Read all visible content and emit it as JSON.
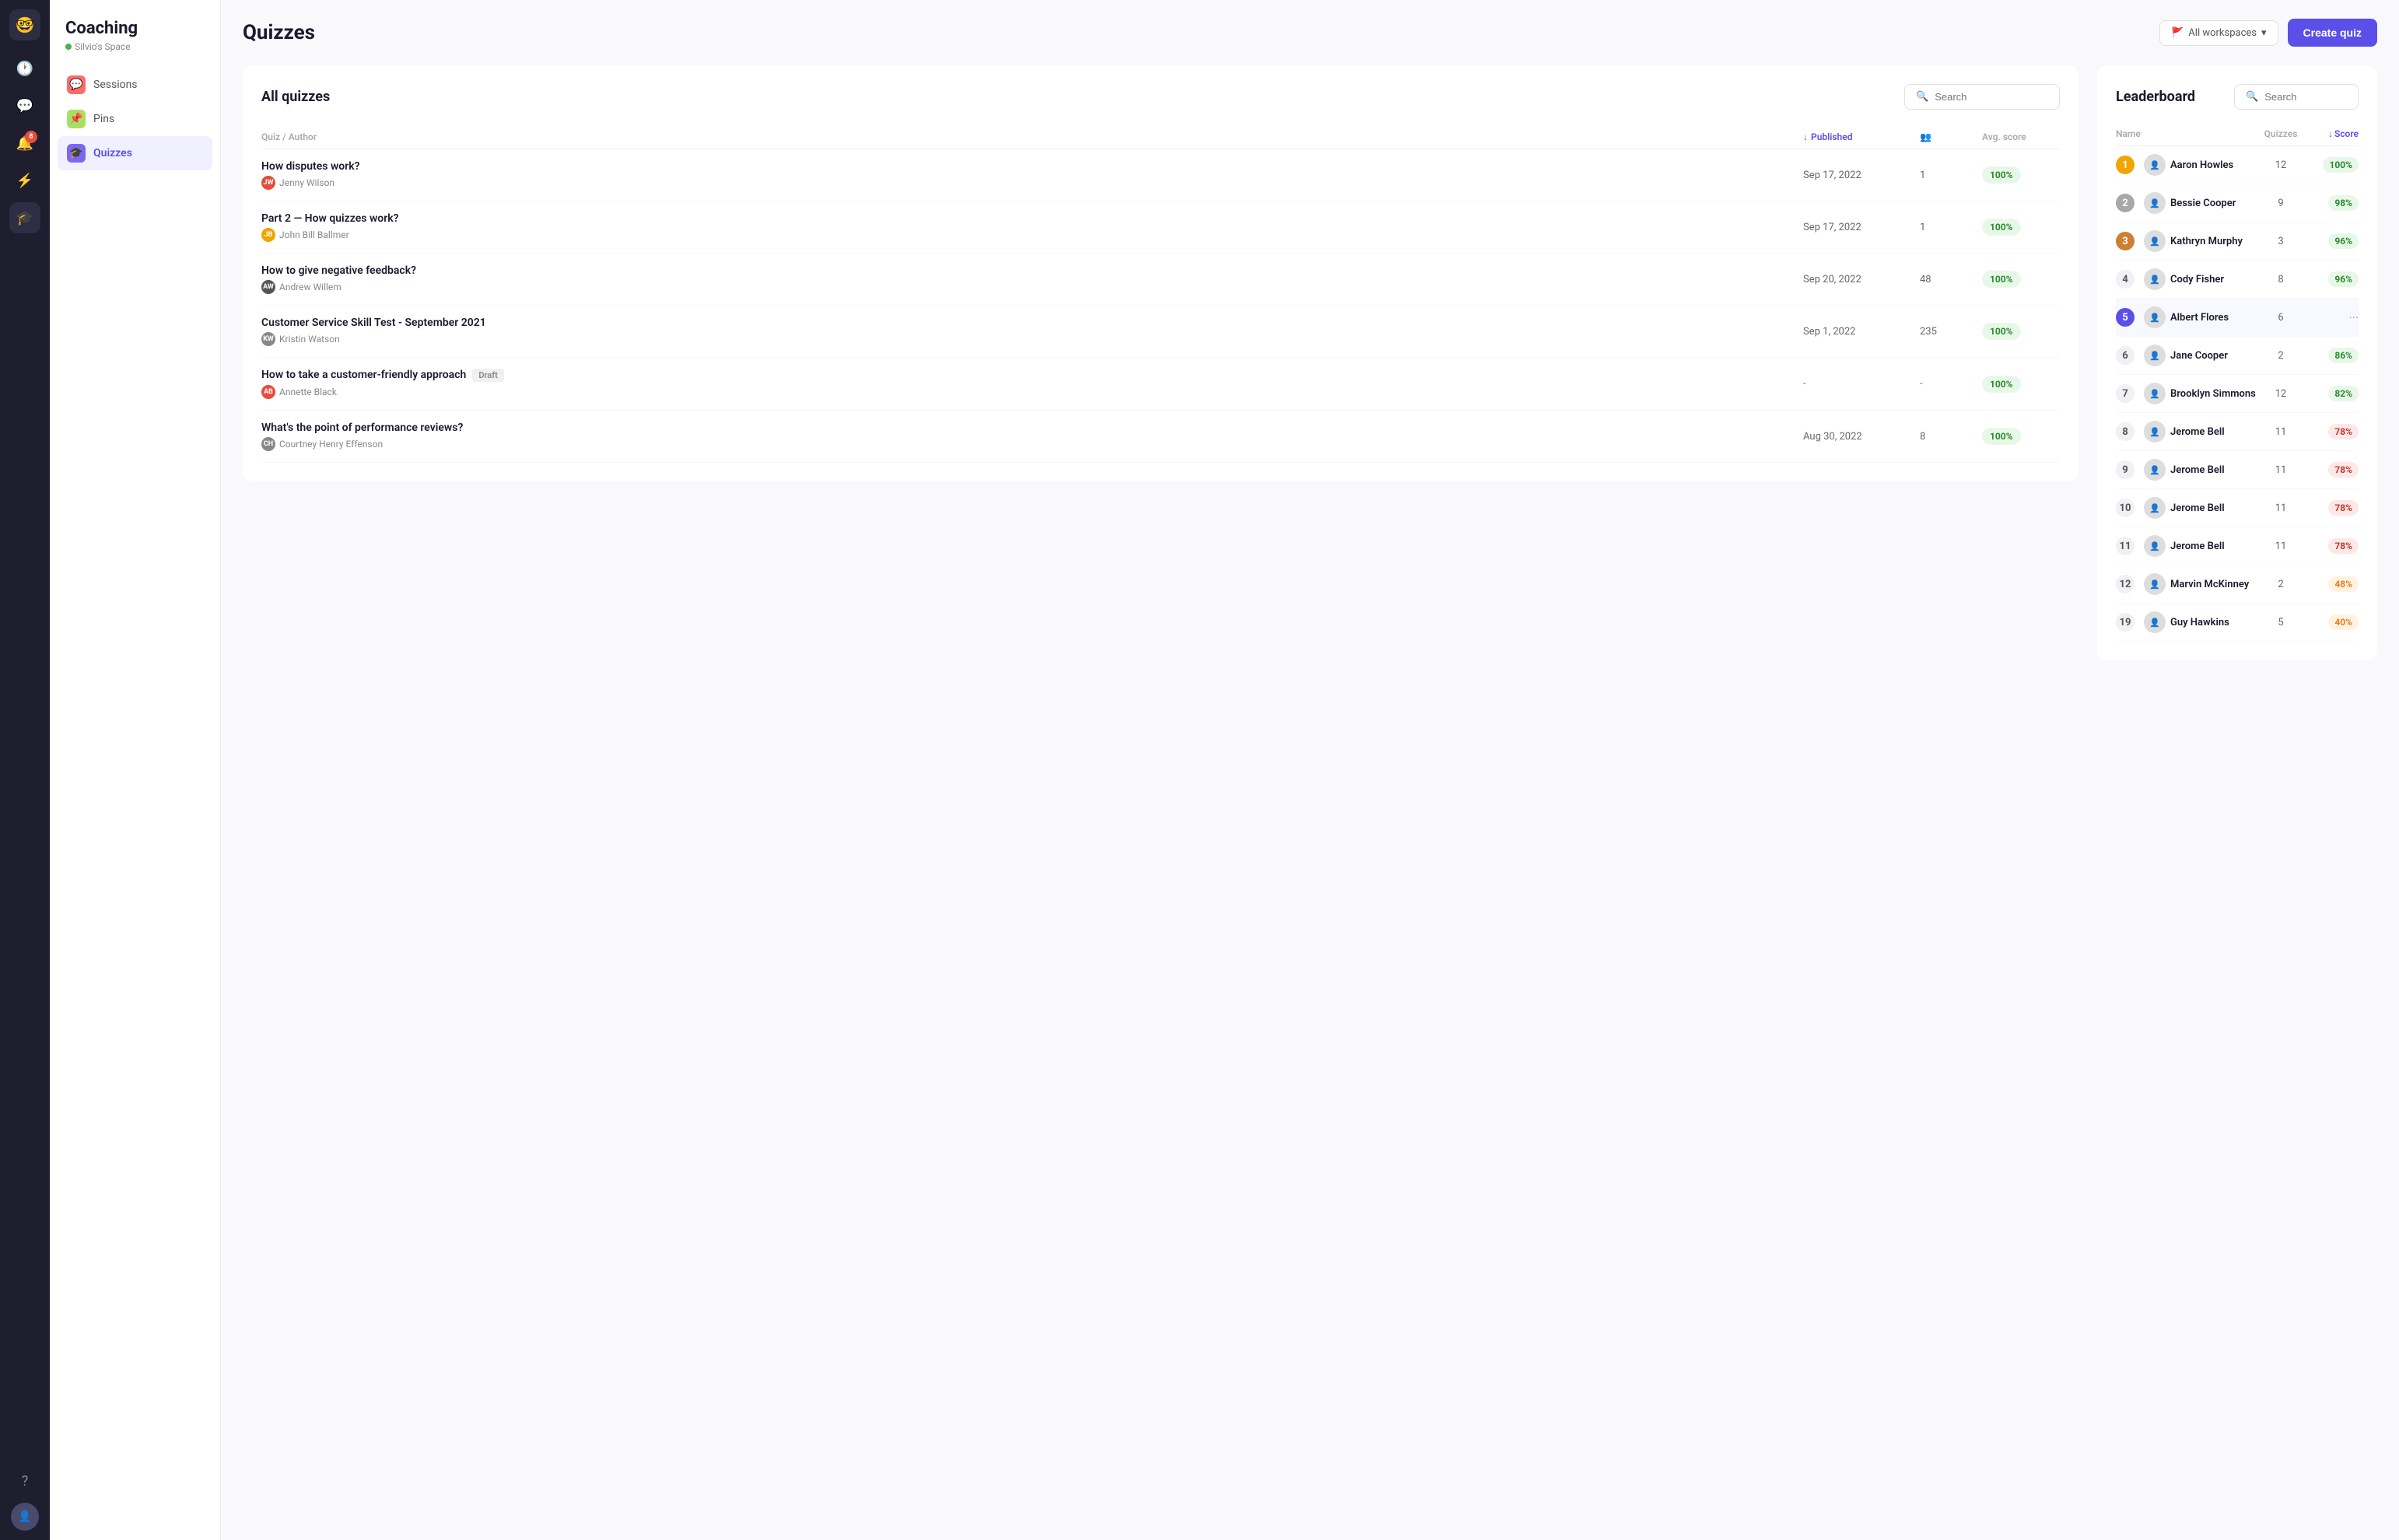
{
  "app": {
    "title": "Coaching",
    "subtitle": "Silvio's Space"
  },
  "nav": {
    "icons": [
      "🕐",
      "💬",
      "🔔",
      "⚡",
      "🎓"
    ],
    "badge": "8",
    "help": "?",
    "workspace_label": "All workspaces"
  },
  "sidebar": {
    "items": [
      {
        "id": "sessions",
        "label": "Sessions",
        "icon": "💬",
        "color": "#ff6b6b",
        "active": false
      },
      {
        "id": "pins",
        "label": "Pins",
        "icon": "📌",
        "color": "#a8e063",
        "active": false
      },
      {
        "id": "quizzes",
        "label": "Quizzes",
        "icon": "🎓",
        "color": "#7b68ee",
        "active": true
      }
    ]
  },
  "main": {
    "title": "Quizzes",
    "create_button": "Create quiz",
    "all_quizzes_title": "All quizzes",
    "search_placeholder": "Search",
    "table_headers": {
      "quiz_author": "Quiz / Author",
      "published": "Published",
      "participants": "",
      "avg_score": "Avg. score"
    },
    "quizzes": [
      {
        "title": "How disputes work?",
        "author": "Jenny Wilson",
        "author_color": "#e74c3c",
        "date": "Sep 17, 2022",
        "participants": "1",
        "score": "100%",
        "score_type": "green",
        "draft": false
      },
      {
        "title": "Part 2 — How quizzes work?",
        "author": "John Bill Ballmer",
        "author_color": "#f0a500",
        "date": "Sep 17, 2022",
        "participants": "1",
        "score": "100%",
        "score_type": "green",
        "draft": false
      },
      {
        "title": "How to give negative feedback?",
        "author": "Andrew Willem",
        "author_color": "#555",
        "date": "Sep 20, 2022",
        "participants": "48",
        "score": "100%",
        "score_type": "green",
        "draft": false
      },
      {
        "title": "Customer Service Skill Test - September 2021",
        "author": "Kristin Watson",
        "author_color": "#888",
        "date": "Sep 1, 2022",
        "participants": "235",
        "score": "100%",
        "score_type": "green",
        "draft": false
      },
      {
        "title": "How to take a customer-friendly approach",
        "author": "Annette Black",
        "author_color": "#e74c3c",
        "date": "-",
        "participants": "-",
        "score": "100%",
        "score_type": "green",
        "draft": true
      },
      {
        "title": "What's the point of performance reviews?",
        "author": "Courtney Henry Effenson",
        "author_color": "#888",
        "date": "Aug 30, 2022",
        "participants": "8",
        "score": "100%",
        "score_type": "green",
        "draft": false
      }
    ]
  },
  "leaderboard": {
    "title": "Leaderboard",
    "search_placeholder": "Search",
    "headers": {
      "name": "Name",
      "quizzes": "Quizzes",
      "score": "Score"
    },
    "entries": [
      {
        "rank": "1",
        "rank_type": "gold",
        "name": "Aaron Howles",
        "quizzes": "12",
        "score": "100%",
        "score_type": "green"
      },
      {
        "rank": "2",
        "rank_type": "silver",
        "name": "Bessie Cooper",
        "quizzes": "9",
        "score": "98%",
        "score_type": "green"
      },
      {
        "rank": "3",
        "rank_type": "bronze",
        "name": "Kathryn Murphy",
        "quizzes": "3",
        "score": "96%",
        "score_type": "green"
      },
      {
        "rank": "4",
        "rank_type": "default",
        "name": "Cody Fisher",
        "quizzes": "8",
        "score": "96%",
        "score_type": "green"
      },
      {
        "rank": "5",
        "rank_type": "blue",
        "name": "Albert Flores",
        "quizzes": "6",
        "score": "...",
        "score_type": "dots",
        "hover": true
      },
      {
        "rank": "6",
        "rank_type": "default",
        "name": "Jane Cooper",
        "quizzes": "2",
        "score": "86%",
        "score_type": "green"
      },
      {
        "rank": "7",
        "rank_type": "default",
        "name": "Brooklyn Simmons",
        "quizzes": "12",
        "score": "82%",
        "score_type": "green"
      },
      {
        "rank": "8",
        "rank_type": "default",
        "name": "Jerome Bell",
        "quizzes": "11",
        "score": "78%",
        "score_type": "red"
      },
      {
        "rank": "9",
        "rank_type": "default",
        "name": "Jerome Bell",
        "quizzes": "11",
        "score": "78%",
        "score_type": "red"
      },
      {
        "rank": "10",
        "rank_type": "default",
        "name": "Jerome Bell",
        "quizzes": "11",
        "score": "78%",
        "score_type": "red"
      },
      {
        "rank": "11",
        "rank_type": "default",
        "name": "Jerome Bell",
        "quizzes": "11",
        "score": "78%",
        "score_type": "red"
      },
      {
        "rank": "12",
        "rank_type": "default",
        "name": "Marvin McKinney",
        "quizzes": "2",
        "score": "48%",
        "score_type": "orange"
      },
      {
        "rank": "19",
        "rank_type": "default",
        "name": "Guy Hawkins",
        "quizzes": "5",
        "score": "40%",
        "score_type": "orange"
      }
    ]
  }
}
